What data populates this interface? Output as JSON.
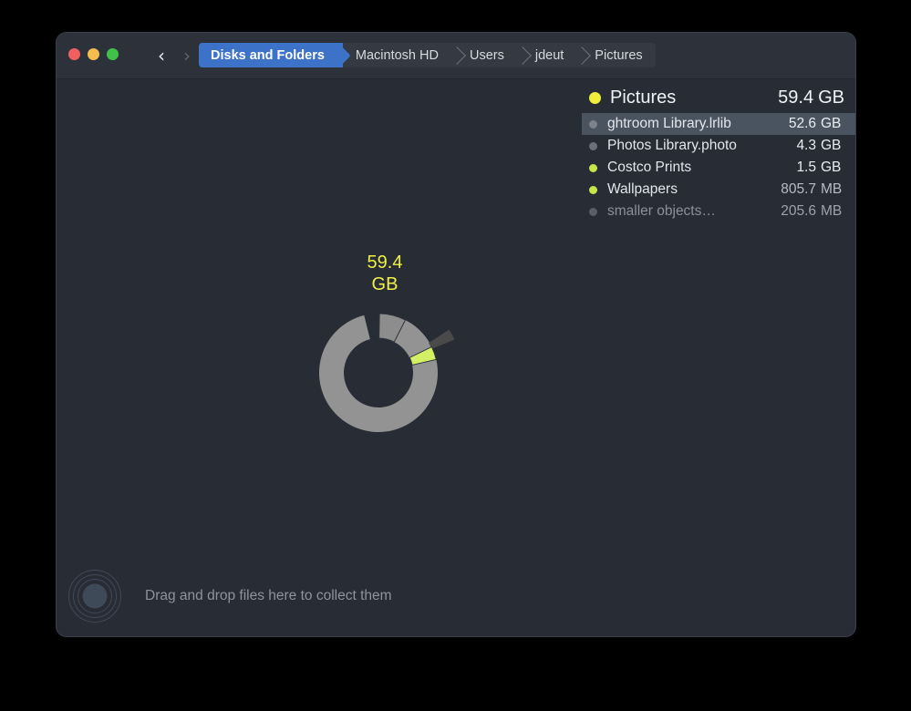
{
  "window": {
    "traffic_lights": [
      {
        "name": "close",
        "color": "#f1605e"
      },
      {
        "name": "minimize",
        "color": "#f5bd4f"
      },
      {
        "name": "zoom",
        "color": "#3fc14a"
      }
    ],
    "nav": {
      "back_glyph": "‹",
      "forward_glyph": "›"
    },
    "breadcrumbs": [
      {
        "label": "Disks and Folders",
        "active": true
      },
      {
        "label": "Macintosh HD",
        "active": false
      },
      {
        "label": "Users",
        "active": false
      },
      {
        "label": "jdeut",
        "active": false
      },
      {
        "label": "Pictures",
        "active": false
      }
    ]
  },
  "listing": {
    "header": {
      "name": "Pictures",
      "size": "59.4",
      "unit": "GB",
      "bullet_color": "#f0f03a"
    },
    "rows": [
      {
        "name": "ghtroom Library.lrlib",
        "size": "52.6",
        "unit": "GB",
        "bullet_color": "#7d828b",
        "selected": true,
        "dim": false,
        "clipped": true
      },
      {
        "name": "Photos Library.photo",
        "size": "4.3",
        "unit": "GB",
        "bullet_color": "#6b7078",
        "selected": false,
        "dim": false,
        "clipped": true
      },
      {
        "name": "Costco Prints",
        "size": "1.5",
        "unit": "GB",
        "bullet_color": "#c3e64a",
        "selected": false,
        "dim": false,
        "clipped": false
      },
      {
        "name": "Wallpapers",
        "size": "805.7",
        "unit": "MB",
        "bullet_color": "#c3e64a",
        "selected": false,
        "dim": false,
        "clipped": false
      },
      {
        "name": "smaller objects…",
        "size": "205.6",
        "unit": "MB",
        "bullet_color": "#5a5f67",
        "selected": false,
        "dim": true,
        "clipped": false
      }
    ]
  },
  "chart_data": {
    "type": "pie",
    "title": "Pictures disk usage",
    "center_value": "59.4",
    "center_unit": "GB",
    "total_gb": 59.4,
    "units": "GB",
    "legend_position": "right-panel",
    "donut_inner_radius": 38,
    "donut_outer_radius": 65,
    "categories": [
      "ghtroom Library.lrlib",
      "Photos Library.photo",
      "Costco Prints",
      "Wallpapers",
      "smaller objects…"
    ],
    "values": [
      52.6,
      4.3,
      1.5,
      0.8057,
      0.2056
    ],
    "colors": [
      "#939393",
      "#8e8e8e",
      "#d3ef63",
      "#c3e64a",
      "#4a4a4a"
    ],
    "slices": [
      {
        "label": "ghtroom Library.lrlib",
        "value": 52.6,
        "unit": "GB",
        "percent": 88.6,
        "color": "#939393",
        "start_deg": -63,
        "end_deg": 256,
        "exploded": false
      },
      {
        "label": "Photos Library.photo",
        "value": 4.3,
        "unit": "GB",
        "percent": 7.2,
        "color": "#8d8d8d",
        "start_deg": -89,
        "end_deg": -63,
        "exploded": false
      },
      {
        "label": "Costco Prints",
        "value": 1.5,
        "unit": "GB",
        "percent": 2.5,
        "color": "#d3ef63",
        "start_deg": -26,
        "end_deg": -13,
        "exploded": true
      },
      {
        "label": "Wallpapers",
        "value": 0.8057,
        "unit": "MB-scaled",
        "percent": 1.3,
        "color": "#4a4a4a",
        "start_deg": -33,
        "end_deg": -22,
        "exploded": true
      },
      {
        "label": "smaller objects…",
        "value": 0.2056,
        "unit": "MB-scaled",
        "percent": 0.3,
        "color": "#4a4a4a",
        "start_deg": -13,
        "end_deg": -10,
        "exploded": false
      }
    ]
  },
  "dropzone": {
    "text": "Drag and drop files here to collect them",
    "icon": "concentric-rings"
  }
}
